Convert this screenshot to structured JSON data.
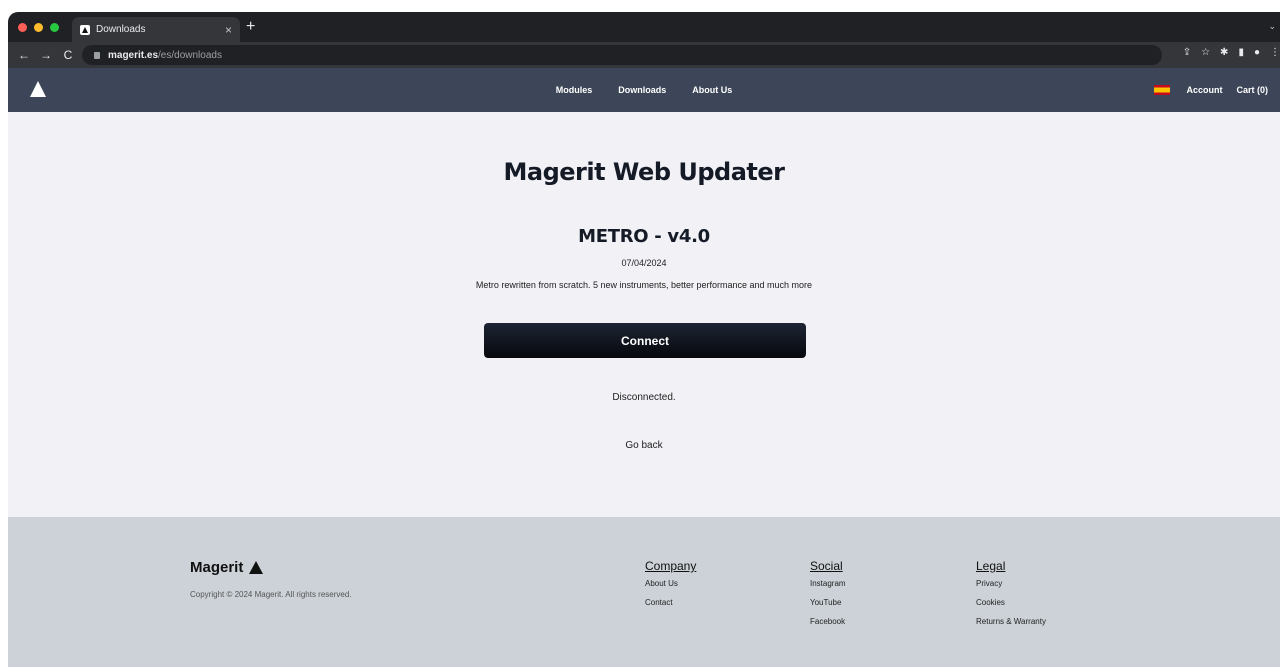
{
  "browser": {
    "tab_title": "Downloads",
    "tab_close": "×",
    "new_tab": "+",
    "url_domain": "magerit.es",
    "url_path": "/es/downloads"
  },
  "header": {
    "nav": [
      "Modules",
      "Downloads",
      "About Us"
    ],
    "account": "Account",
    "cart": "Cart (0)"
  },
  "main": {
    "title": "Magerit Web Updater",
    "firmware_title": "METRO - v4.0",
    "date": "07/04/2024",
    "description": "Metro rewritten from scratch. 5 new instruments, better performance and much more",
    "connect_label": "Connect",
    "status": "Disconnected.",
    "go_back": "Go back"
  },
  "footer": {
    "brand": "Magerit",
    "copyright": "Copyright © 2024 Magerit. All rights reserved.",
    "company": {
      "heading": "Company",
      "links": [
        "About Us",
        "Contact"
      ]
    },
    "social": {
      "heading": "Social",
      "links": [
        "Instagram",
        "YouTube",
        "Facebook"
      ]
    },
    "legal": {
      "heading": "Legal",
      "links": [
        "Privacy",
        "Cookies",
        "Returns & Warranty"
      ]
    }
  }
}
